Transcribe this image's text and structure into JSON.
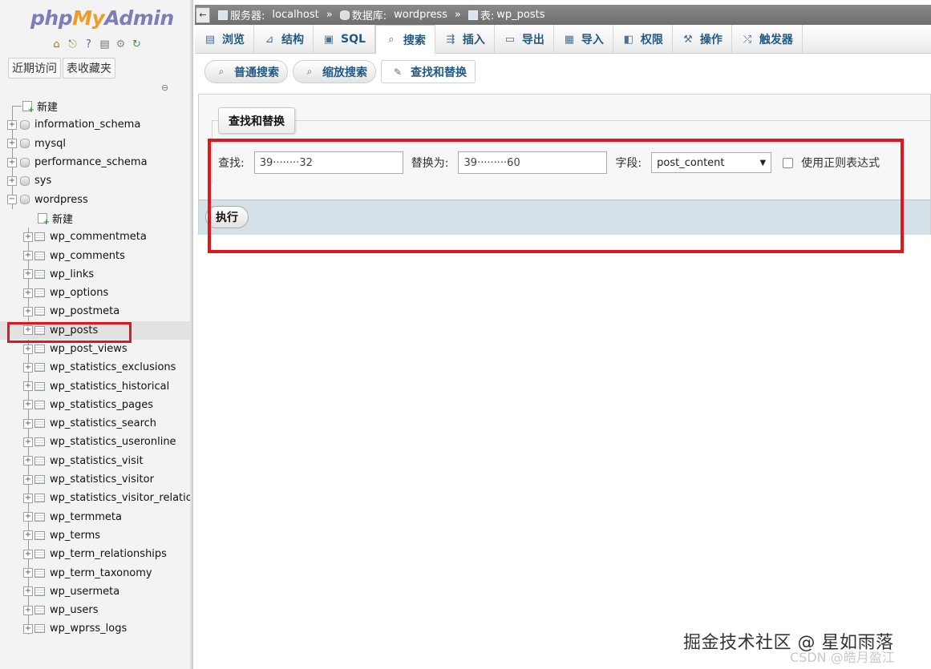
{
  "logo": {
    "php": "php",
    "my": "My",
    "admin": "Admin"
  },
  "quick_icons": [
    "home-icon",
    "exit-icon",
    "query-icon",
    "docs-icon",
    "settings-icon",
    "reload-icon"
  ],
  "sidebar_tabs": [
    "近期访问",
    "表收藏夹"
  ],
  "tree": {
    "new_root": "新建",
    "databases": [
      "information_schema",
      "mysql",
      "performance_schema",
      "sys",
      "wordpress"
    ],
    "new_table": "新建",
    "tables": [
      "wp_commentmeta",
      "wp_comments",
      "wp_links",
      "wp_options",
      "wp_postmeta",
      "wp_posts",
      "wp_post_views",
      "wp_statistics_exclusions",
      "wp_statistics_historical",
      "wp_statistics_pages",
      "wp_statistics_search",
      "wp_statistics_useronline",
      "wp_statistics_visit",
      "wp_statistics_visitor",
      "wp_statistics_visitor_relationships",
      "wp_termmeta",
      "wp_terms",
      "wp_term_relationships",
      "wp_term_taxonomy",
      "wp_usermeta",
      "wp_users",
      "wp_wprss_logs"
    ]
  },
  "breadcrumb": {
    "back": "←",
    "server_label": "服务器:",
    "server": "localhost",
    "sep": "»",
    "db_label": "数据库:",
    "db": "wordpress",
    "table_label": "表:",
    "table": "wp_posts"
  },
  "tabs": [
    "浏览",
    "结构",
    "SQL",
    "搜索",
    "插入",
    "导出",
    "导入",
    "权限",
    "操作",
    "触发器"
  ],
  "active_tab": "搜索",
  "subtabs": [
    "普通搜索",
    "缩放搜索",
    "查找和替换"
  ],
  "form": {
    "legend": "查找和替换",
    "find_label": "查找:",
    "find_value": "39········32",
    "replace_label": "替换为:",
    "replace_value": "39·········60",
    "field_label": "字段:",
    "field_value": "post_content",
    "regex_label": "使用正则表达式",
    "regex_checked": false,
    "go_button": "执行"
  },
  "watermark": {
    "line1": "掘金技术社区 @ 星如雨落",
    "line2": "CSDN @皓月盈江"
  },
  "colors": {
    "highlight": "#e0161c",
    "link": "#235a81"
  }
}
